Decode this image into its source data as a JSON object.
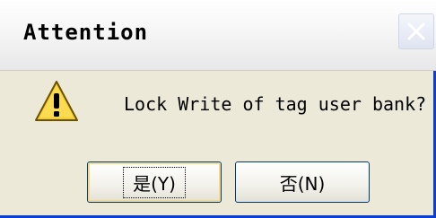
{
  "dialog": {
    "title": "Attention",
    "message": "Lock Write of tag user bank?",
    "yes_label": "是(Y)",
    "no_label": "否(N)",
    "icon": "warning-icon",
    "close_icon": "close-icon"
  },
  "colors": {
    "frame": "#0a3fd0",
    "background": "#ece9d8",
    "button_border": "#003c74",
    "warning_yellow": "#f4cf2c"
  }
}
